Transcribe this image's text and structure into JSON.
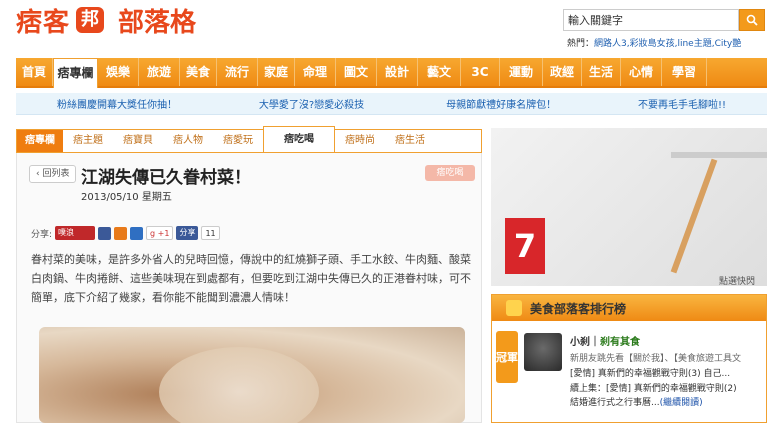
{
  "logo": {
    "main": "痞客",
    "bubble": "邦",
    "sub": "部落格"
  },
  "search": {
    "placeholder": "輸入關鍵字"
  },
  "hot": {
    "label": "熱門：",
    "keywords": "網路人3,彩妝島女孩,line主題,City艷"
  },
  "nav": [
    "首頁",
    "痞專欄",
    "娛樂",
    "旅遊",
    "美食",
    "流行",
    "家庭",
    "命理",
    "圖文",
    "設計",
    "藝文",
    "3C",
    "運動",
    "政經",
    "生活",
    "心情",
    "學習"
  ],
  "promo": [
    "粉絲團慶開幕大獎任你抽！",
    "大學愛了沒?戀愛必殺技",
    "母親節獻禮好康名牌包！",
    "不要再毛手毛腳啦!!"
  ],
  "subnav": {
    "current": "痞專欄",
    "items": [
      "痞主題",
      "痞寶貝",
      "痞人物",
      "痞愛玩",
      "痞吃喝",
      "痞時尚",
      "痞生活"
    ]
  },
  "article": {
    "back": "回列表",
    "title": "江湖失傳已久眷村菜！",
    "tag": "痞吃喝",
    "date": "2013/05/10 星期五",
    "share_label": "分享:",
    "share_count": "11",
    "plus_label": "+1",
    "share_fb": "分享",
    "share_plurk": "噗浪",
    "body": "眷村菜的美味，是許多外省人的兒時回憶，傳說中的紅燒獅子頭、手工水餃、牛肉麵、酸菜白肉鍋、牛肉捲餅、這些美味現在到處都有，但要吃到江湖中失傳已久的正港眷村味，可不簡單，底下介紹了幾家，看你能不能聞到濃濃人情味！"
  },
  "ad": {
    "number": "7",
    "caption": "點選快閃"
  },
  "rank": {
    "title": "美食部落客排行榜",
    "badge": "冠軍",
    "author_prefix": "小刹｜",
    "author": "刹有其食",
    "line1": "新朋友跳先看【關於我】、【美食旅遊工具文",
    "line2": "[愛情] 真新們的幸福觀戰守則(3) 自己...",
    "line3": "續上集：[愛情] 真新們的幸福觀戰守則(2)",
    "line4": "結婚進行式之行事曆...",
    "line4_link": "(繼續閱讀)"
  },
  "colors": {
    "brand": "#e8481c",
    "nav": "#ef8a14",
    "link": "#1a60b0"
  }
}
